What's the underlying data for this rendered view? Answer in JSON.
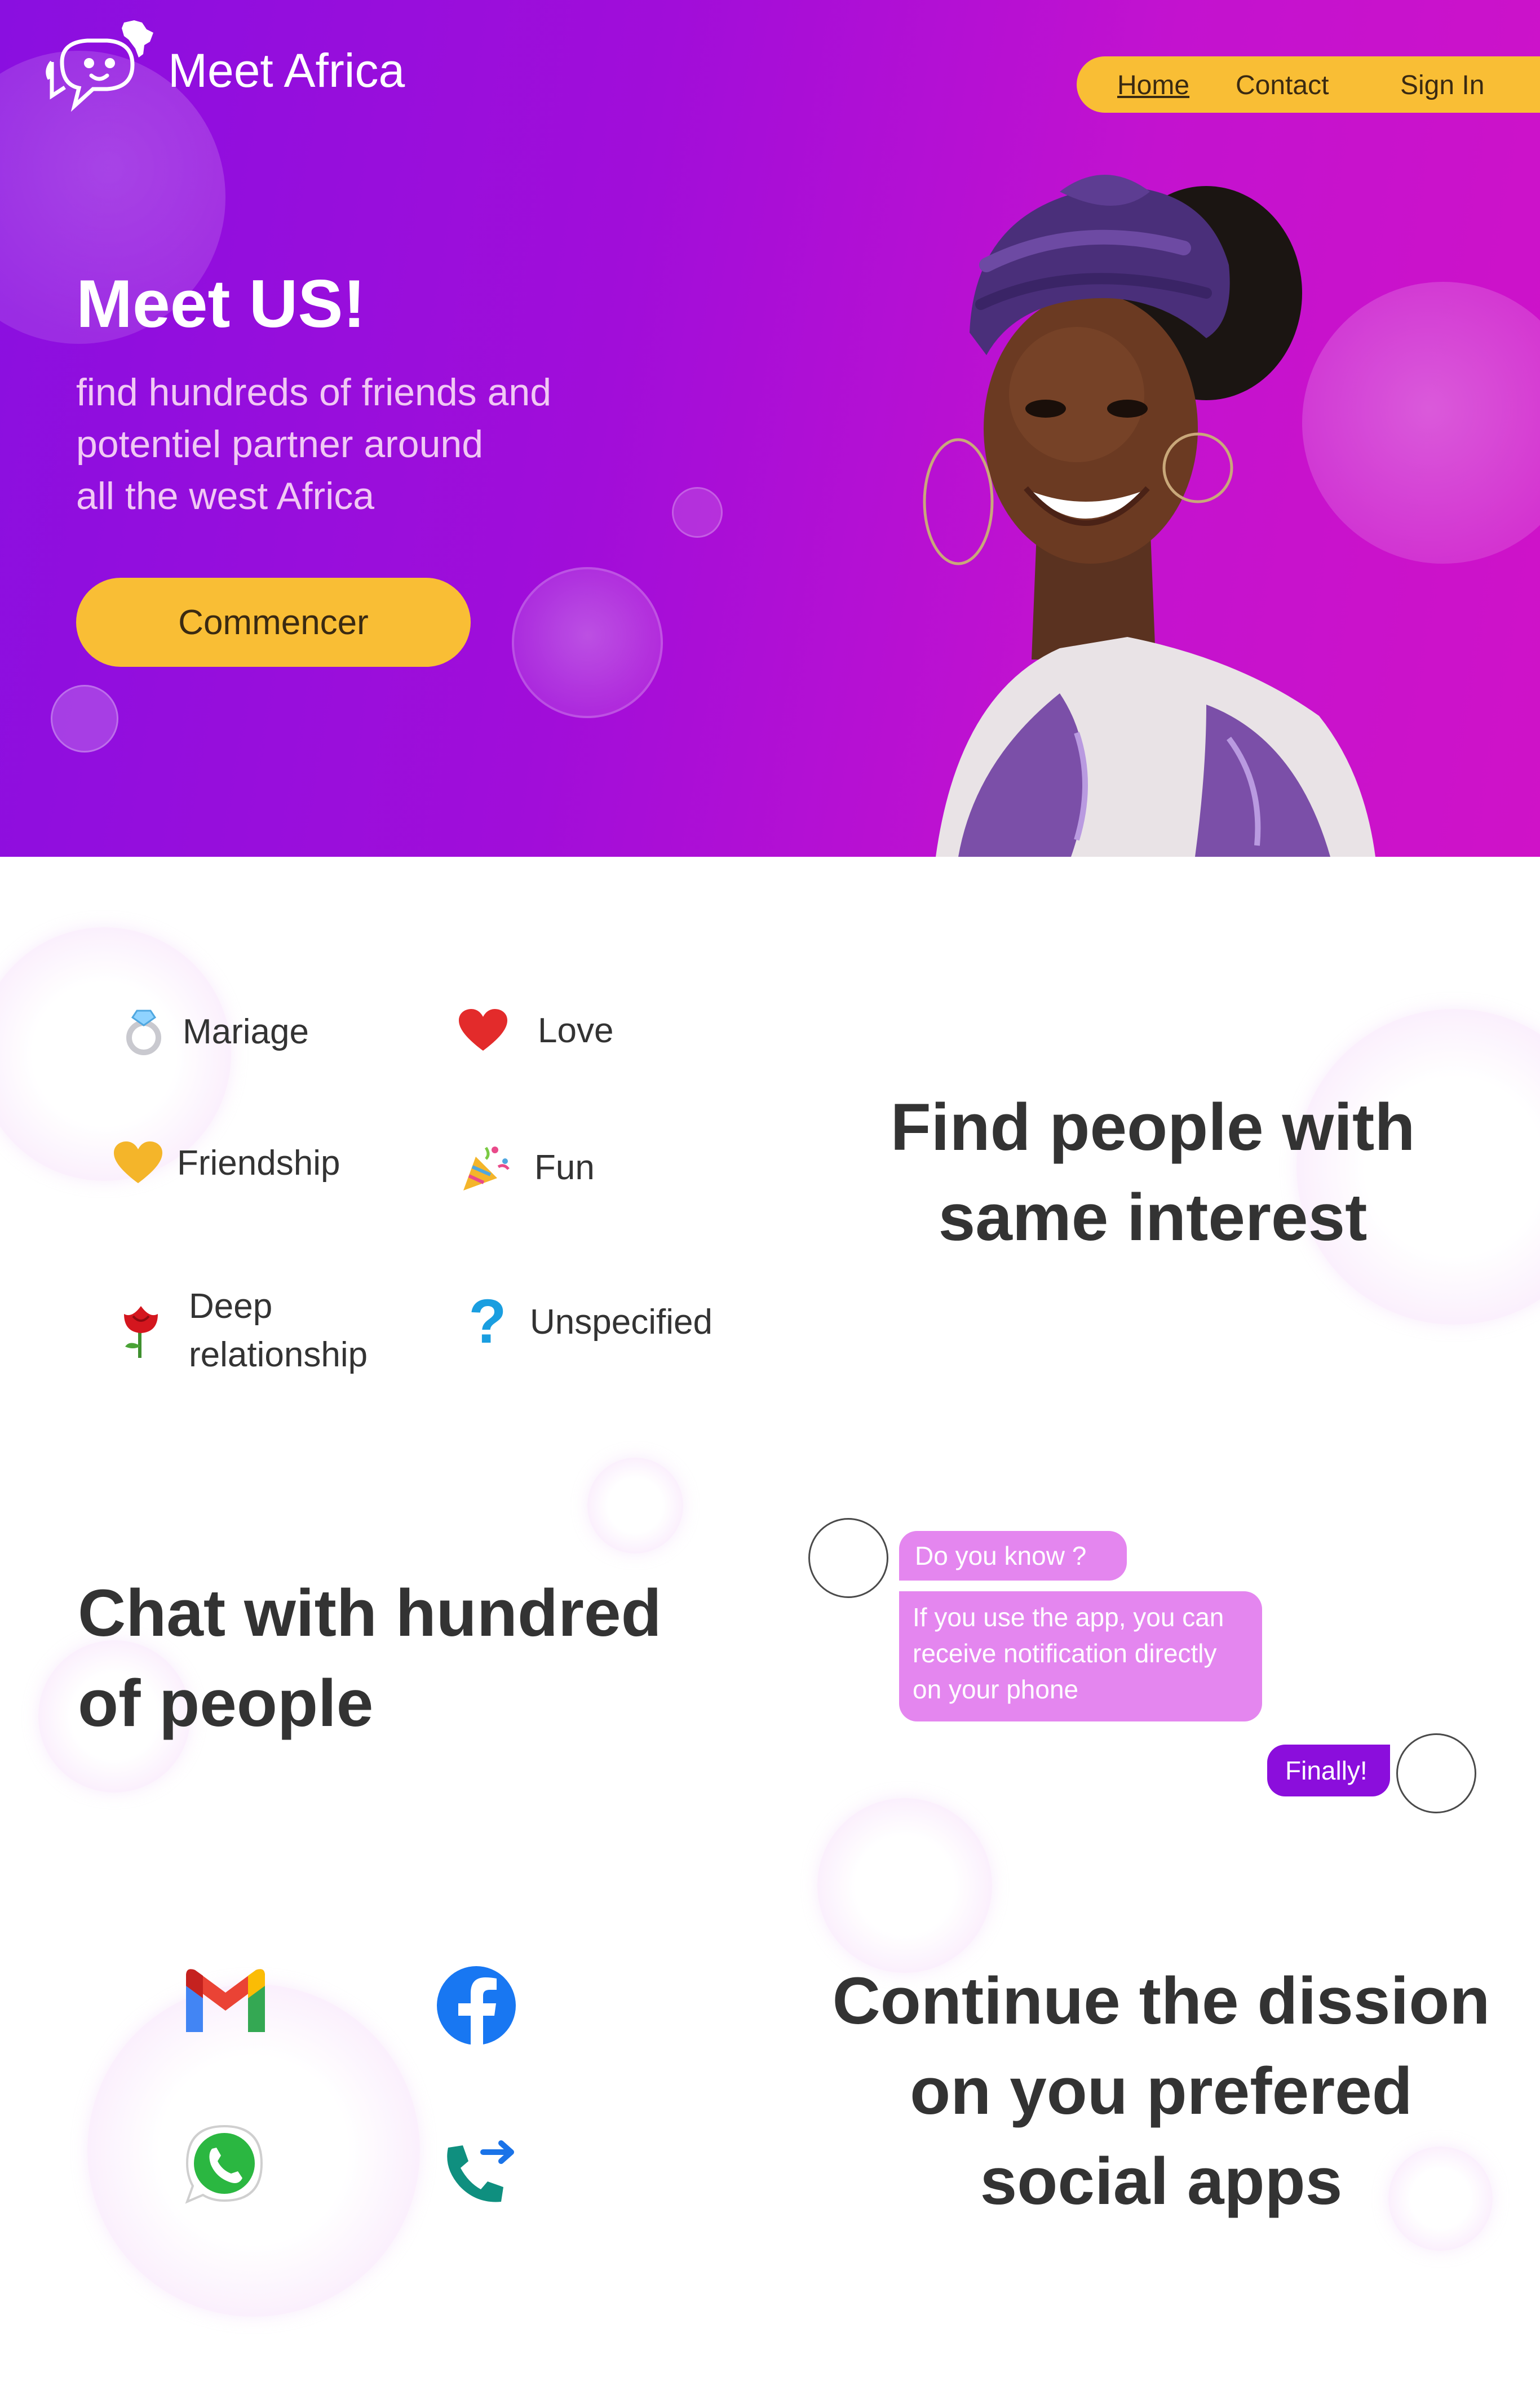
{
  "app": {
    "brand_name": "Meet Africa",
    "accent_color": "#f9be35",
    "hero_gradient": [
      "#8a0fe0",
      "#cf12c8"
    ]
  },
  "nav": {
    "items": [
      {
        "label": "Home",
        "active": true
      },
      {
        "label": "Contact"
      },
      {
        "label": "Sign In"
      }
    ]
  },
  "hero": {
    "title": "Meet US!",
    "subtitle_lines": [
      "find hundreds of friends and",
      "potentiel partner around",
      "all the west Africa"
    ],
    "cta_label": "Commencer",
    "image": "smiling-woman-portrait"
  },
  "interests": {
    "items": [
      {
        "label": "Mariage",
        "icon": "ring-icon"
      },
      {
        "label": "Love",
        "icon": "heart-icon"
      },
      {
        "label": "Friendship",
        "icon": "yellow-heart-icon"
      },
      {
        "label": "Fun",
        "icon": "party-popper-icon"
      },
      {
        "label_line1": "Deep",
        "label_line2": "relationship",
        "icon": "rose-icon"
      },
      {
        "label": "Unspecified",
        "icon": "question-mark-icon"
      }
    ],
    "title_line1": "Find people with",
    "title_line2": "same interest"
  },
  "chat": {
    "title_line1": "Chat with hundred",
    "title_line2": "of people",
    "messages": [
      {
        "text": "Do you know ?",
        "color": "#e486ef"
      },
      {
        "line1": "If you use the app, you can",
        "line2": "receive notification directly",
        "line3": "on your phone",
        "color": "#e486ef"
      },
      {
        "text": "Finally!",
        "color": "#8b0edc"
      }
    ]
  },
  "social": {
    "apps": [
      "gmail-icon",
      "facebook-icon",
      "whatsapp-icon",
      "call-forward-icon"
    ],
    "title_line1": "Continue the dission",
    "title_line2": "on you prefered",
    "title_line3": "social apps"
  }
}
